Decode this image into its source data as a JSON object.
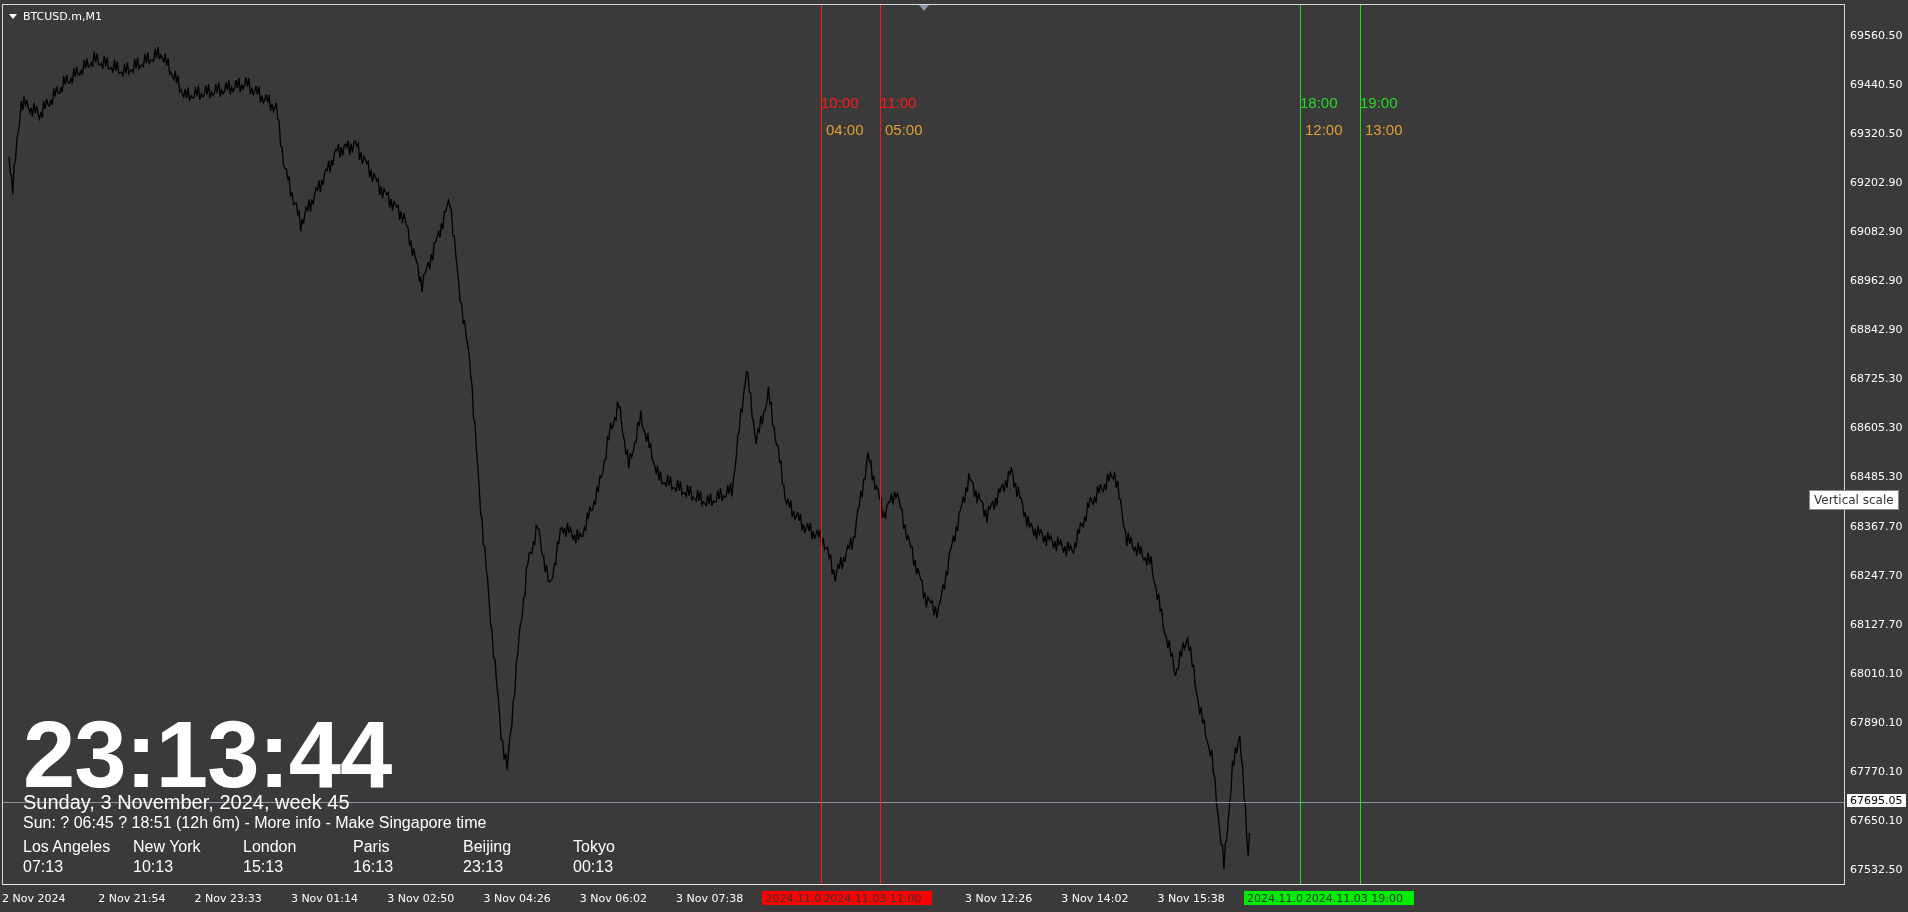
{
  "chart": {
    "symbol": "BTCUSD.m,M1",
    "markers": [
      {
        "time": "10:00",
        "local_time": "04:00",
        "color": "#ff1a1a"
      },
      {
        "time": "11:00",
        "local_time": "05:00",
        "color": "#ff1a1a"
      },
      {
        "time": "18:00",
        "local_time": "12:00",
        "color": "#22dd22"
      },
      {
        "time": "19:00",
        "local_time": "13:00",
        "color": "#22dd22"
      }
    ],
    "price_scale": [
      "69560.50",
      "69440.50",
      "69320.50",
      "69202.90",
      "69082.90",
      "68962.90",
      "68842.90",
      "68725.30",
      "68605.30",
      "68485.30",
      "68367.70",
      "68247.70",
      "68127.70",
      "68010.10",
      "67890.10",
      "67770.10",
      "67650.10",
      "67532.50"
    ],
    "current_price": "67695.05",
    "tooltip": "Vertical scale",
    "time_axis": [
      {
        "kind": "label",
        "text": "2 Nov 2024"
      },
      {
        "kind": "label",
        "text": "2 Nov 21:54"
      },
      {
        "kind": "label",
        "text": "2 Nov 23:33"
      },
      {
        "kind": "label",
        "text": "3 Nov 01:14"
      },
      {
        "kind": "label",
        "text": "3 Nov 02:50"
      },
      {
        "kind": "label",
        "text": "3 Nov 04:26"
      },
      {
        "kind": "label",
        "text": "3 Nov 06:02"
      },
      {
        "kind": "label",
        "text": "3 Nov 07:38"
      },
      {
        "kind": "tag",
        "texts": [
          "2024.11.0",
          "2024.11.03 11:00"
        ],
        "color": "#ff0000"
      },
      {
        "kind": "label",
        "text": "3 Nov 12:26"
      },
      {
        "kind": "label",
        "text": "3 Nov 14:02"
      },
      {
        "kind": "label",
        "text": "3 Nov 15:38"
      },
      {
        "kind": "tag",
        "texts": [
          "2024.11.0",
          "2024.11.03 19:00"
        ],
        "color": "#00ee00"
      }
    ]
  },
  "clock": {
    "time": "23:13:44",
    "date": "Sunday, 3 November, 2024, week 45",
    "sun_info": "Sun: ? 06:45 ? 18:51 (12h 6m) - More info - Make Singapore time",
    "cities": [
      {
        "name": "Los Angeles",
        "time": "07:13"
      },
      {
        "name": "New York",
        "time": "10:13"
      },
      {
        "name": "London",
        "time": "15:13"
      },
      {
        "name": "Paris",
        "time": "16:13"
      },
      {
        "name": "Beijing",
        "time": "23:13"
      },
      {
        "name": "Tokyo",
        "time": "00:13"
      }
    ]
  }
}
